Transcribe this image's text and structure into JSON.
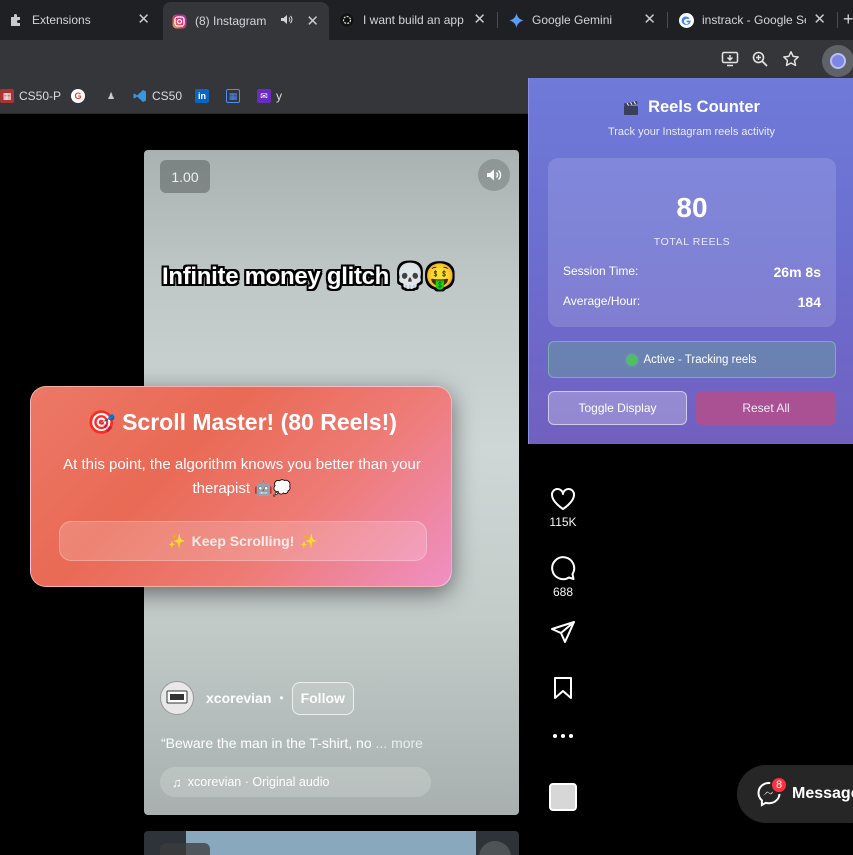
{
  "tabs": [
    {
      "title": "Extensions",
      "icon": "puzzle-icon"
    },
    {
      "title": "(8) Instagram",
      "icon": "instagram-icon",
      "active": true,
      "audio": true
    },
    {
      "title": "I want build an app",
      "icon": "openai-icon"
    },
    {
      "title": "Google Gemini",
      "icon": "gemini-icon"
    },
    {
      "title": "instrack - Google Se",
      "icon": "google-icon"
    }
  ],
  "new_tab_label": "+",
  "bookmarks": [
    {
      "label": "CS50-P",
      "icon": "cs50-icon"
    },
    {
      "label": "",
      "icon": "google-g-icon"
    },
    {
      "label": "",
      "icon": "chess-icon"
    },
    {
      "label": "CS50",
      "icon": "vscode-icon"
    },
    {
      "label": "",
      "icon": "linkedin-icon"
    },
    {
      "label": "",
      "icon": "grid-icon"
    },
    {
      "label": "y",
      "icon": "mail-icon"
    }
  ],
  "reel": {
    "speed": "1.00",
    "caption": "Infinite money glitch 💀🤑",
    "username": "xcorevian",
    "follow_label": "Follow",
    "description": "“Beware the man in the T-shirt, no",
    "more_label": "... more",
    "audio": "xcorevian · Original audio"
  },
  "actions": {
    "likes": "115K",
    "comments": "688"
  },
  "messages": {
    "label": "Messages",
    "badge": "8"
  },
  "scroll_card": {
    "title": "🎯 Scroll Master! (80 Reels!)",
    "message": "At this point, the algorithm knows you better than your therapist 🤖💭",
    "button": "Keep Scrolling!",
    "sparkle": "✨"
  },
  "popup": {
    "title": "Reels Counter",
    "subtitle": "Track your Instagram reels activity",
    "total": "80",
    "total_label": "TOTAL REELS",
    "session_label": "Session Time:",
    "session_value": "26m 8s",
    "avg_label": "Average/Hour:",
    "avg_value": "184",
    "status": "Active - Tracking reels",
    "toggle_label": "Toggle Display",
    "reset_label": "Reset All"
  }
}
